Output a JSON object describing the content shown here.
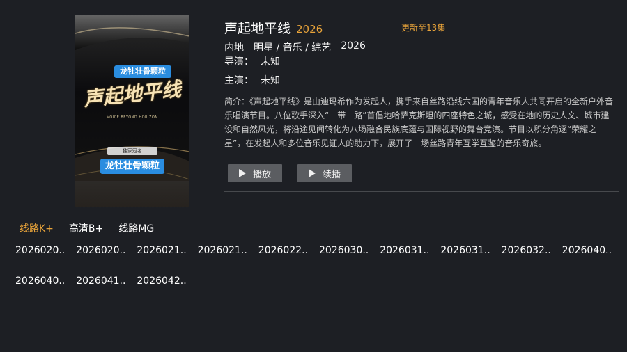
{
  "poster": {
    "top_label": "龙牡壮骨颗粒",
    "calligraphy_title": "声起地平线",
    "english_subtitle": "VOICE BEYOND HORIZON",
    "sponsor_label": "独家冠名",
    "bottom_label": "龙牡壮骨颗粒"
  },
  "detail": {
    "title": "声起地平线",
    "year": "2026",
    "update_status": "更新至13集",
    "region": "内地",
    "genre": "明星 / 音乐 / 综艺",
    "release_year": "2026",
    "director_label": "导演：",
    "director_value": "未知",
    "actor_label": "主演：",
    "actor_value": "未知",
    "description": "简介：《声起地平线》是由迪玛希作为发起人，携手来自丝路沿线六国的青年音乐人共同开启的全新户外音乐唱演节目。八位歌手深入“一带一路”首倡地哈萨克斯坦的四座特色之城，感受在地的历史人文、城市建设和自然风光，将沿途见闻转化为八场融合民族底蕴与国际视野的舞台竞演。节目以积分角逐“荣耀之星”，在发起人和多位音乐见证人的助力下，展开了一场丝路青年互学互鉴的音乐奇旅。"
  },
  "buttons": {
    "play_label": "播放",
    "resume_label": "续播"
  },
  "routes": [
    {
      "label": "线路K+",
      "active": true
    },
    {
      "label": "高清B+",
      "active": false
    },
    {
      "label": "线路MG",
      "active": false
    }
  ],
  "episodes": [
    "2026020..",
    "2026020..",
    "2026021..",
    "2026021..",
    "2026022..",
    "2026030..",
    "2026031..",
    "2026031..",
    "2026032..",
    "2026040..",
    "2026040..",
    "2026041..",
    "2026042.."
  ],
  "colors": {
    "background": "#1d1f24",
    "accent": "#e8a33a",
    "button": "#5b5d61"
  }
}
